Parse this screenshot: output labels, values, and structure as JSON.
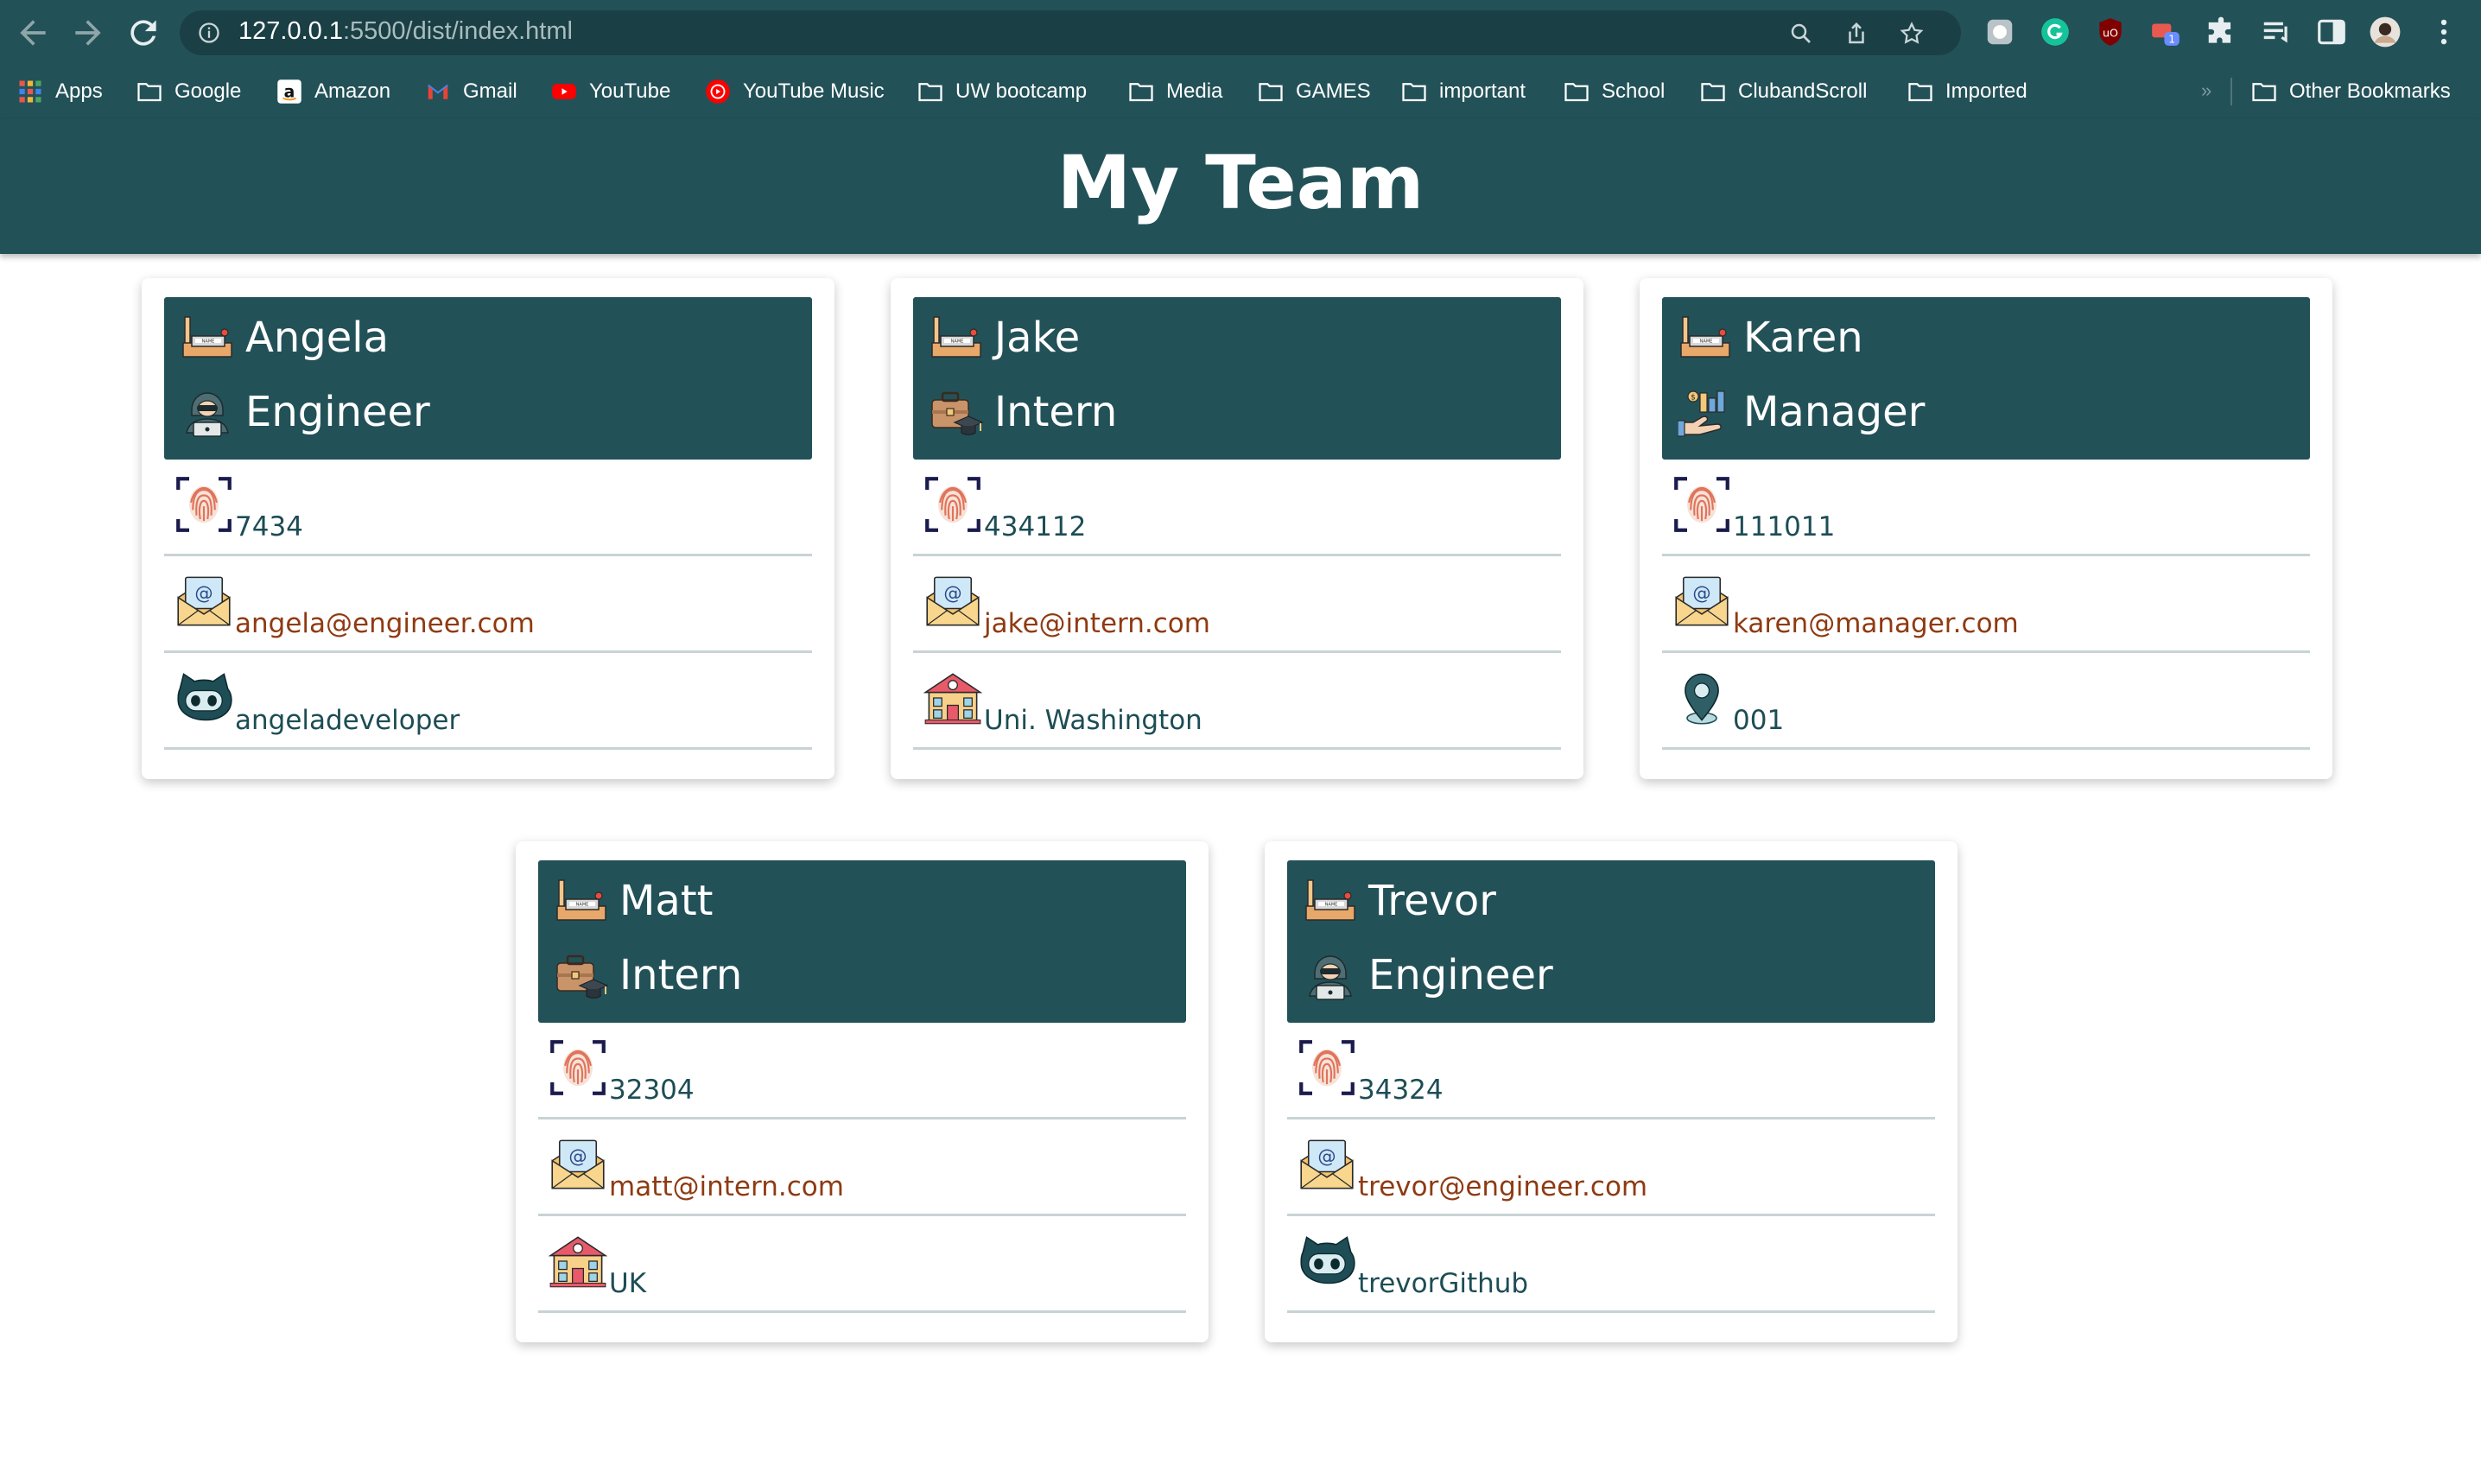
{
  "browser": {
    "url_host": "127.0.0.1",
    "url_rest": ":5500/dist/index.html",
    "bookmarks": [
      {
        "label": "Apps",
        "icon": "apps-grid-icon"
      },
      {
        "label": "Google",
        "icon": "folder-icon"
      },
      {
        "label": "Amazon",
        "icon": "amazon-icon"
      },
      {
        "label": "Gmail",
        "icon": "gmail-icon"
      },
      {
        "label": "YouTube",
        "icon": "youtube-icon"
      },
      {
        "label": "YouTube Music",
        "icon": "youtube-music-icon"
      },
      {
        "label": "UW bootcamp",
        "icon": "folder-icon"
      },
      {
        "label": "Media",
        "icon": "folder-icon"
      },
      {
        "label": "GAMES",
        "icon": "folder-icon"
      },
      {
        "label": "important",
        "icon": "folder-icon"
      },
      {
        "label": "School",
        "icon": "folder-icon"
      },
      {
        "label": "ClubandScroll",
        "icon": "folder-icon"
      },
      {
        "label": "Imported",
        "icon": "folder-icon"
      }
    ],
    "overflow_chevron": "»",
    "other_bookmarks": "Other Bookmarks",
    "extension_badge": "1",
    "colors": {
      "chrome_bg": "#235158",
      "omnibox_bg": "#1a3f45"
    }
  },
  "page": {
    "title": "My Team",
    "colors": {
      "header_bg": "#235158",
      "text": "#1d4d55",
      "link": "#8f3a12",
      "divider": "#c8d3d5"
    }
  },
  "team": [
    {
      "name": "Angela",
      "role": "Engineer",
      "role_icon": "engineer-hacker-icon",
      "id": "7434",
      "email": "angela@engineer.com",
      "extra": "angeladeveloper",
      "extra_icon": "github-icon"
    },
    {
      "name": "Jake",
      "role": "Intern",
      "role_icon": "intern-briefcase-icon",
      "id": "434112",
      "email": "jake@intern.com",
      "extra": "Uni. Washington",
      "extra_icon": "school-icon"
    },
    {
      "name": "Karen",
      "role": "Manager",
      "role_icon": "manager-hand-chart-icon",
      "id": "111011",
      "email": "karen@manager.com",
      "extra": "001",
      "extra_icon": "location-pin-icon"
    },
    {
      "name": "Matt",
      "role": "Intern",
      "role_icon": "intern-briefcase-icon",
      "id": "32304",
      "email": "matt@intern.com",
      "extra": "UK",
      "extra_icon": "school-icon"
    },
    {
      "name": "Trevor",
      "role": "Engineer",
      "role_icon": "engineer-hacker-icon",
      "id": "34324",
      "email": "trevor@engineer.com",
      "extra": "trevorGithub",
      "extra_icon": "github-icon"
    }
  ]
}
